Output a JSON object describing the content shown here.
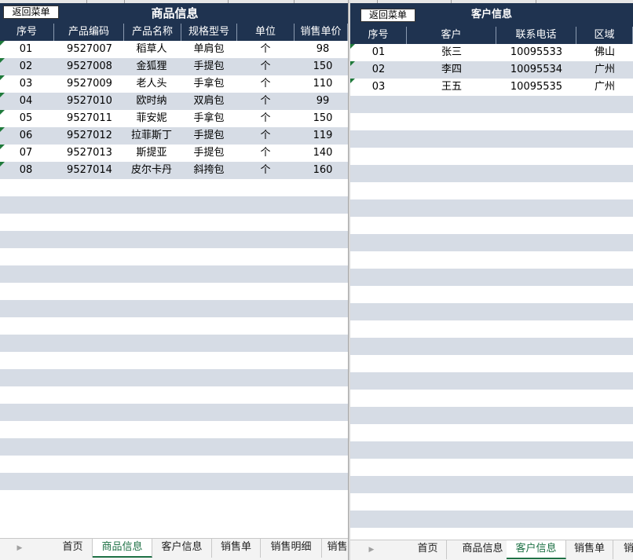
{
  "left_sheet": {
    "menu_button": "返回菜单",
    "title": "商品信息",
    "headers": [
      "序号",
      "产品编码",
      "产品名称",
      "规格型号",
      "单位",
      "销售单价"
    ],
    "rows": [
      [
        "01",
        "9527007",
        "稻草人",
        "单肩包",
        "个",
        "98"
      ],
      [
        "02",
        "9527008",
        "金狐狸",
        "手提包",
        "个",
        "150"
      ],
      [
        "03",
        "9527009",
        "老人头",
        "手拿包",
        "个",
        "110"
      ],
      [
        "04",
        "9527010",
        "欧时纳",
        "双肩包",
        "个",
        "99"
      ],
      [
        "05",
        "9527011",
        "菲安妮",
        "手拿包",
        "个",
        "150"
      ],
      [
        "06",
        "9527012",
        "拉菲斯丁",
        "手提包",
        "个",
        "119"
      ],
      [
        "07",
        "9527013",
        "斯提亚",
        "手提包",
        "个",
        "140"
      ],
      [
        "08",
        "9527014",
        "皮尔卡丹",
        "斜挎包",
        "个",
        "160"
      ]
    ],
    "tabs": [
      "首页",
      "商品信息",
      "客户信息",
      "销售单",
      "销售明细",
      "销售"
    ],
    "active_tab": "商品信息"
  },
  "right_sheet": {
    "menu_button": "返回菜单",
    "title": "客户信息",
    "headers": [
      "序号",
      "客户",
      "联系电话",
      "区域"
    ],
    "rows": [
      [
        "01",
        "张三",
        "10095533",
        "佛山"
      ],
      [
        "02",
        "李四",
        "10095534",
        "广州"
      ],
      [
        "03",
        "王五",
        "10095535",
        "广州"
      ]
    ],
    "tabs": [
      "首页",
      "商品信息",
      "客户信息",
      "销售单",
      "销"
    ],
    "active_tab": "客户信息"
  },
  "colors": {
    "header_bg": "#1f3350",
    "band_row": "#d6dce5",
    "active_tab_text": "#1e7145"
  }
}
